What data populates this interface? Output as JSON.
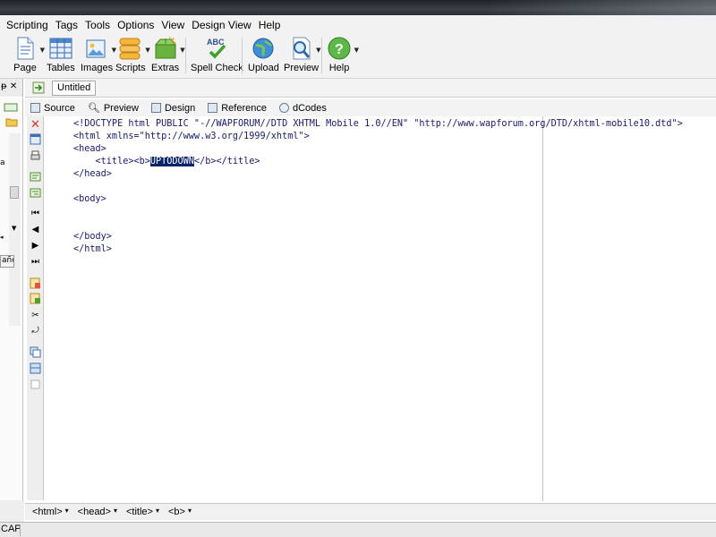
{
  "menu": {
    "items": [
      "Scripting",
      "Tags",
      "Tools",
      "Options",
      "View",
      "Design View",
      "Help"
    ]
  },
  "toolbar": {
    "buttons": [
      {
        "label": "Page",
        "icon": "page-icon"
      },
      {
        "label": "Tables",
        "icon": "table-grid-icon"
      },
      {
        "label": "Images",
        "icon": "images-icon"
      },
      {
        "label": "Scripts",
        "icon": "scripts-icon"
      },
      {
        "label": "Extras",
        "icon": "extras-icon"
      },
      {
        "label": "Spell Check",
        "icon": "spell-check-icon",
        "icon_text": "ABC"
      },
      {
        "label": "Upload",
        "icon": "globe-upload-icon"
      },
      {
        "label": "Preview",
        "icon": "magnifier-preview-icon"
      },
      {
        "label": "Help",
        "icon": "help-icon",
        "icon_text": "?"
      }
    ]
  },
  "tabs": {
    "document_tab": "Untitled"
  },
  "left_panel": {
    "top_glyphs": "ᵽ ✕",
    "cut_text": "a",
    "tab_label": "año"
  },
  "view_tabs": [
    {
      "label": "Source"
    },
    {
      "label": "Preview"
    },
    {
      "label": "Design"
    },
    {
      "label": "Reference"
    },
    {
      "label": "dCodes"
    }
  ],
  "code": {
    "lines": [
      {
        "text": "<!DOCTYPE html PUBLIC \"-//WAPFORUM//DTD XHTML Mobile 1.0//EN\" \"http://www.wapforum.org/DTD/xhtml-mobile10.dtd\">"
      },
      {
        "text": "<html xmlns=\"http://www.w3.org/1999/xhtml\">"
      },
      {
        "text": "<head>"
      },
      {
        "before": "    <title><b>",
        "selected": "UPTODOWN",
        "after": "</b></title>"
      },
      {
        "text": "</head>"
      },
      {
        "text": ""
      },
      {
        "text": "<body>"
      },
      {
        "text": ""
      },
      {
        "text": ""
      },
      {
        "text": "</body>"
      },
      {
        "text": "</html>"
      }
    ]
  },
  "tag_breadcrumb": [
    "<html>",
    "<head>",
    "<title>",
    "<b>"
  ],
  "status": {
    "caps": "CAP"
  },
  "colors": {
    "selection": "#0a246a",
    "code_text": "#1a1a66",
    "close_x": "#d23a1e"
  }
}
